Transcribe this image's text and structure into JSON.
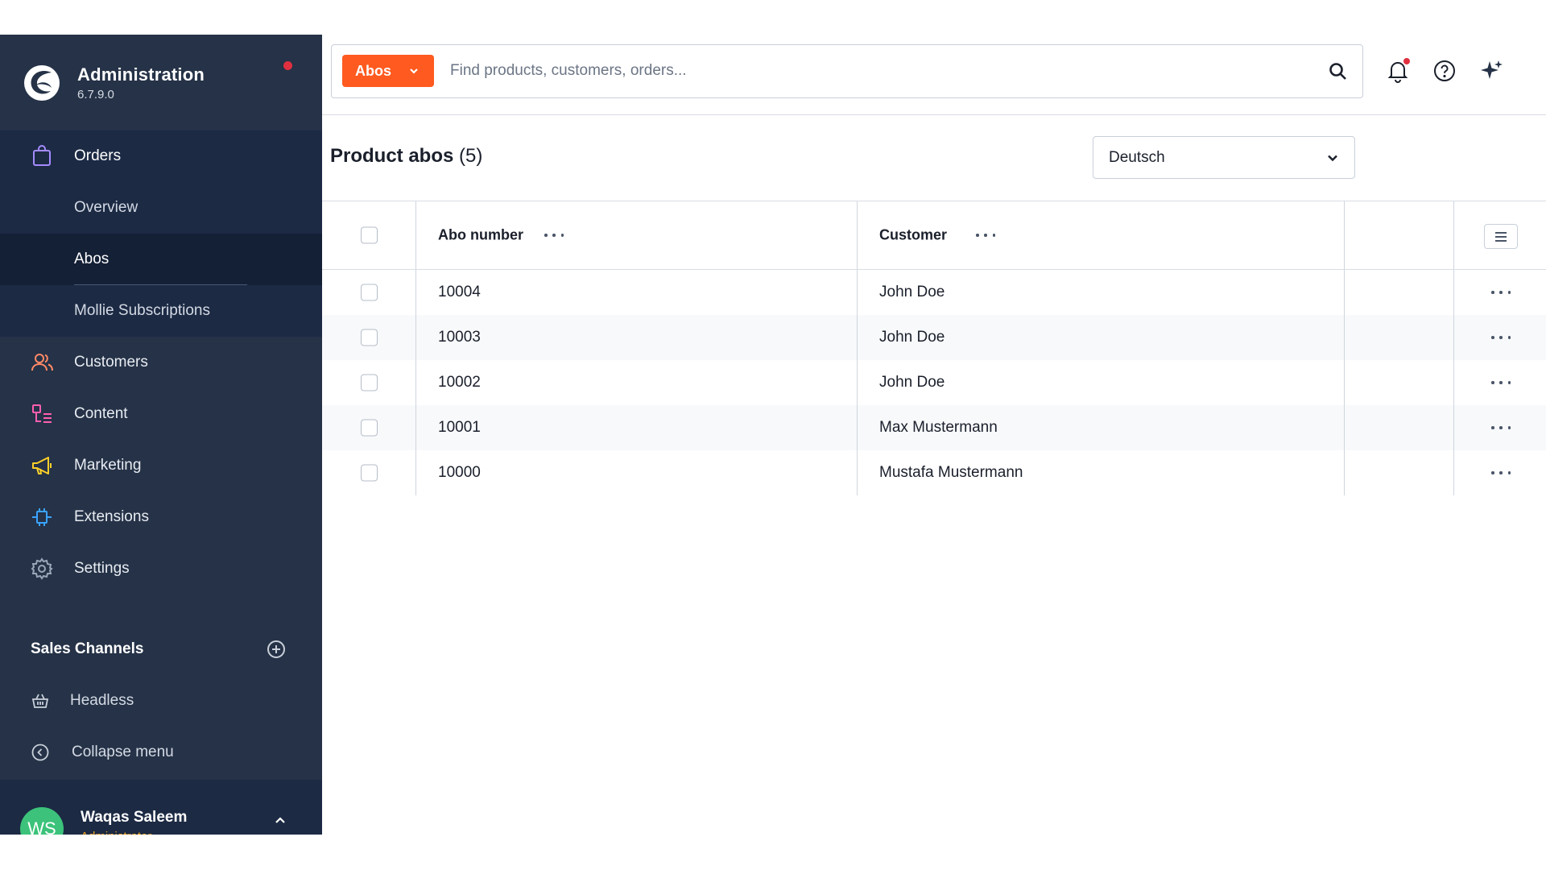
{
  "brand": {
    "title": "Administration",
    "version": "6.7.9.0"
  },
  "nav": {
    "orders": {
      "label": "Orders",
      "sub": [
        {
          "label": "Overview"
        },
        {
          "label": "Abos"
        },
        {
          "label": "Mollie Subscriptions"
        }
      ]
    },
    "items": [
      {
        "label": "Customers",
        "icon": "customers-icon"
      },
      {
        "label": "Content",
        "icon": "content-icon"
      },
      {
        "label": "Marketing",
        "icon": "marketing-icon"
      },
      {
        "label": "Extensions",
        "icon": "extensions-icon"
      },
      {
        "label": "Settings",
        "icon": "settings-icon"
      }
    ]
  },
  "sales_channels": {
    "title": "Sales Channels",
    "items": [
      {
        "label": "Headless"
      }
    ],
    "collapse_label": "Collapse menu"
  },
  "user": {
    "name": "Waqas Saleem",
    "initials": "WS",
    "role": "Administrator"
  },
  "search": {
    "type_label": "Abos",
    "placeholder": "Find products, customers, orders..."
  },
  "page": {
    "title": "Product abos",
    "count": "(5)"
  },
  "language_select": {
    "value": "Deutsch"
  },
  "grid": {
    "columns": [
      "Abo number",
      "Customer"
    ],
    "rows": [
      {
        "abo_number": "10004",
        "customer": "John Doe"
      },
      {
        "abo_number": "10003",
        "customer": "John Doe"
      },
      {
        "abo_number": "10002",
        "customer": "John Doe"
      },
      {
        "abo_number": "10001",
        "customer": "Max Mustermann"
      },
      {
        "abo_number": "10000",
        "customer": "Mustafa Mustermann"
      }
    ]
  },
  "colors": {
    "sidebar_bg": "#253247",
    "sidebar_active_group": "#1c2a44",
    "accent": "#ff5a1f",
    "notification_dot": "#e0303f",
    "avatar_bg": "#3cc27a",
    "orders_icon": "#a58bff",
    "customers_icon": "#ff8a66",
    "content_icon": "#ff5fb0",
    "marketing_icon": "#ffd02a",
    "extensions_icon": "#3aa3ff",
    "settings_icon": "#9aa5b8"
  }
}
